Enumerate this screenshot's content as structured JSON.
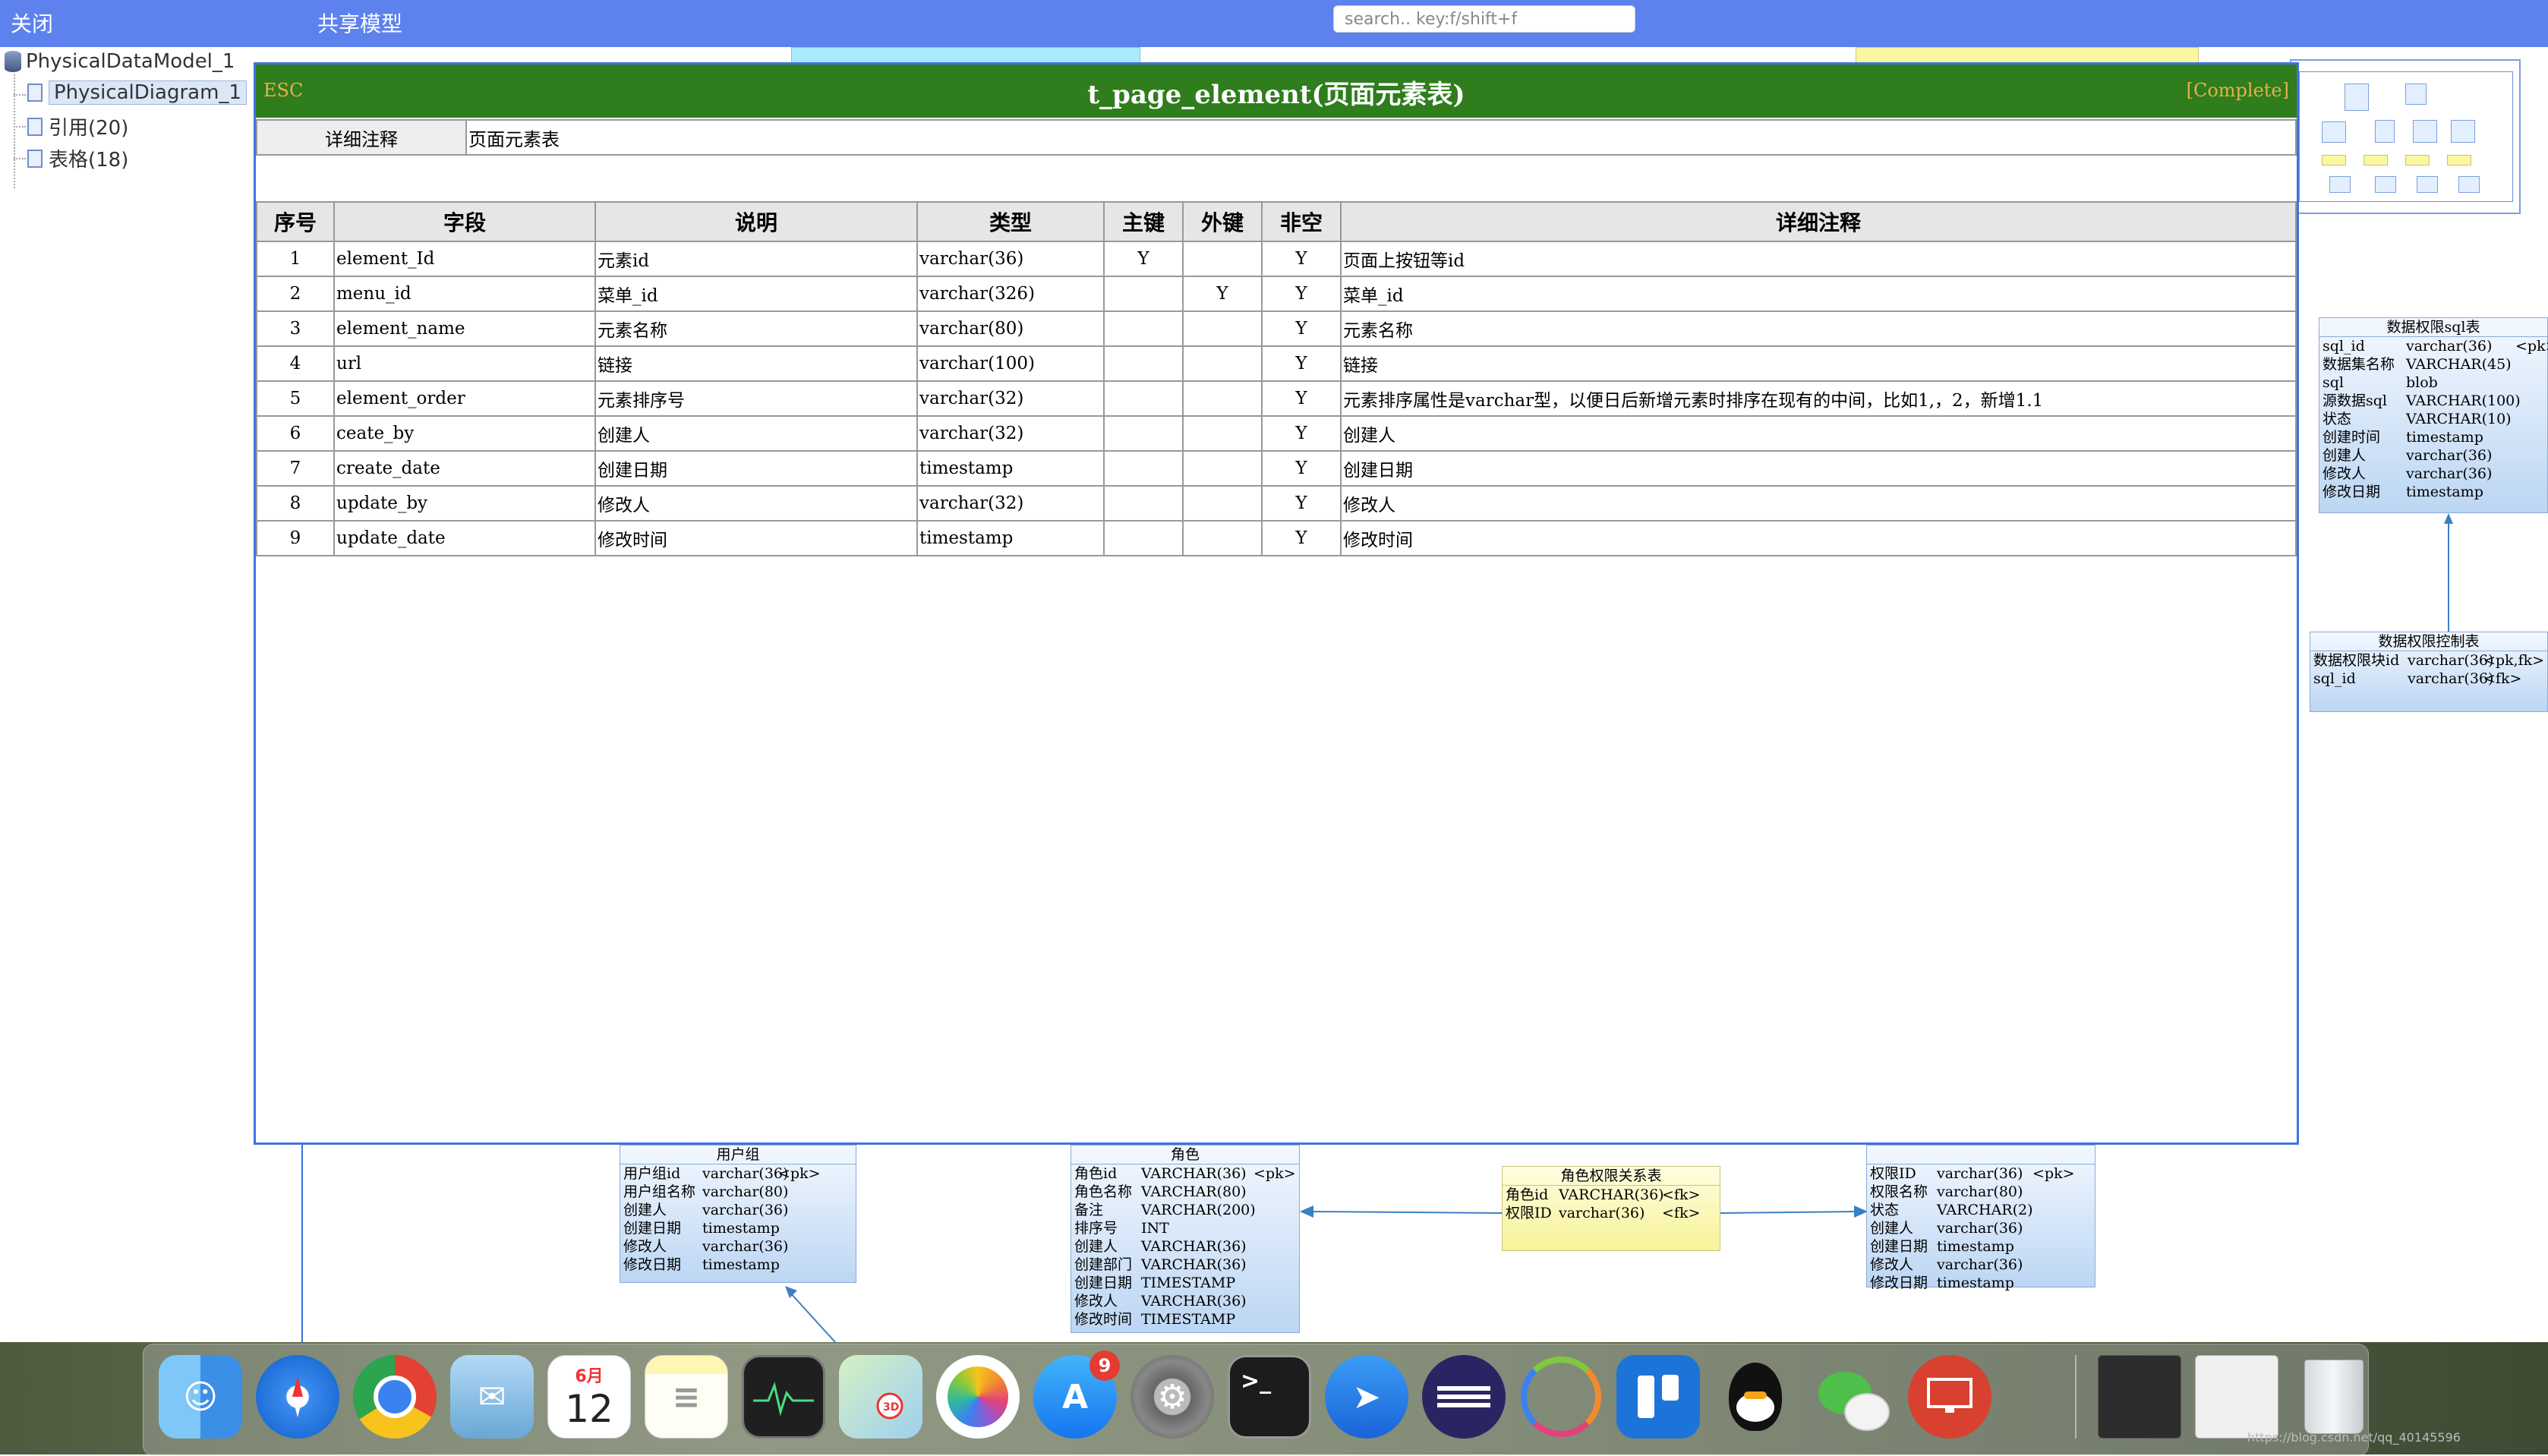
{
  "topbar": {
    "close_label": "关闭",
    "share_label": "共享模型",
    "search_placeholder": "search.. key:f/shift+f"
  },
  "tree": {
    "root": "PhysicalDataModel_1",
    "diagram": "PhysicalDiagram_1",
    "references": "引用(20)",
    "tables": "表格(18)"
  },
  "modal": {
    "esc_label": "ESC",
    "title": "t_page_element(页面元素表)",
    "complete_label": "[Complete]",
    "note_label": "详细注释",
    "note_value": "页面元素表",
    "columns": [
      "序号",
      "字段",
      "说明",
      "类型",
      "主键",
      "外键",
      "非空",
      "详细注释"
    ],
    "rows": [
      {
        "no": "1",
        "field": "element_Id",
        "desc": "元素id",
        "type": "varchar(36)",
        "pk": "Y",
        "fk": "",
        "nn": "Y",
        "note": "页面上按钮等id"
      },
      {
        "no": "2",
        "field": "menu_id",
        "desc": "菜单_id",
        "type": "varchar(326)",
        "pk": "",
        "fk": "Y",
        "nn": "Y",
        "note": "菜单_id"
      },
      {
        "no": "3",
        "field": "element_name",
        "desc": "元素名称",
        "type": "varchar(80)",
        "pk": "",
        "fk": "",
        "nn": "Y",
        "note": "元素名称"
      },
      {
        "no": "4",
        "field": "url",
        "desc": "链接",
        "type": "varchar(100)",
        "pk": "",
        "fk": "",
        "nn": "Y",
        "note": "链接"
      },
      {
        "no": "5",
        "field": "element_order",
        "desc": "元素排序号",
        "type": "varchar(32)",
        "pk": "",
        "fk": "",
        "nn": "Y",
        "note": "元素排序属性是varchar型，以便日后新增元素时排序在现有的中间，比如1,，2，新增1.1"
      },
      {
        "no": "6",
        "field": "ceate_by",
        "desc": "创建人",
        "type": "varchar(32)",
        "pk": "",
        "fk": "",
        "nn": "Y",
        "note": "创建人"
      },
      {
        "no": "7",
        "field": "create_date",
        "desc": "创建日期",
        "type": "timestamp",
        "pk": "",
        "fk": "",
        "nn": "Y",
        "note": "创建日期"
      },
      {
        "no": "8",
        "field": "update_by",
        "desc": "修改人",
        "type": "varchar(32)",
        "pk": "",
        "fk": "",
        "nn": "Y",
        "note": "修改人"
      },
      {
        "no": "9",
        "field": "update_date",
        "desc": "修改时间",
        "type": "timestamp",
        "pk": "",
        "fk": "",
        "nn": "Y",
        "note": "修改时间"
      }
    ]
  },
  "entities": {
    "sql_table": {
      "title": "数据权限sql表",
      "rows": [
        [
          "sql_id",
          "varchar(36)",
          "<pk>"
        ],
        [
          "数据集名称",
          "VARCHAR(45)",
          ""
        ],
        [
          "sql",
          "blob",
          ""
        ],
        [
          "源数据sql",
          "VARCHAR(100)",
          ""
        ],
        [
          "状态",
          "VARCHAR(10)",
          ""
        ],
        [
          "创建时间",
          "timestamp",
          ""
        ],
        [
          "创建人",
          "varchar(36)",
          ""
        ],
        [
          "修改人",
          "varchar(36)",
          ""
        ],
        [
          "修改日期",
          "timestamp",
          ""
        ]
      ]
    },
    "control_table": {
      "title": "数据权限控制表",
      "rows": [
        [
          "数据权限块id",
          "varchar(36)",
          "<pk,fk>"
        ],
        [
          "sql_id",
          "varchar(36)",
          "<fk>"
        ]
      ]
    },
    "user_group": {
      "title": "用户组",
      "rows": [
        [
          "用户组id",
          "varchar(36)",
          "<pk>"
        ],
        [
          "用户组名称",
          "varchar(80)",
          ""
        ],
        [
          "创建人",
          "varchar(36)",
          ""
        ],
        [
          "创建日期",
          "timestamp",
          ""
        ],
        [
          "修改人",
          "varchar(36)",
          ""
        ],
        [
          "修改日期",
          "timestamp",
          ""
        ]
      ]
    },
    "role": {
      "title": "角色",
      "rows": [
        [
          "角色id",
          "VARCHAR(36)",
          "<pk>"
        ],
        [
          "角色名称",
          "VARCHAR(80)",
          ""
        ],
        [
          "备注",
          "VARCHAR(200)",
          ""
        ],
        [
          "排序号",
          "INT",
          ""
        ],
        [
          "创建人",
          "VARCHAR(36)",
          ""
        ],
        [
          "创建部门",
          "VARCHAR(36)",
          ""
        ],
        [
          "创建日期",
          "TIMESTAMP",
          ""
        ],
        [
          "修改人",
          "VARCHAR(36)",
          ""
        ],
        [
          "修改时间",
          "TIMESTAMP",
          ""
        ]
      ]
    },
    "role_perm": {
      "title": "角色权限关系表",
      "rows": [
        [
          "角色id",
          "VARCHAR(36)",
          "<fk>"
        ],
        [
          "权限ID",
          "varchar(36)",
          "<fk>"
        ]
      ]
    },
    "permission": {
      "title": "",
      "rows": [
        [
          "权限ID",
          "varchar(36)",
          "<pk>"
        ],
        [
          "权限名称",
          "varchar(80)",
          ""
        ],
        [
          "状态",
          "VARCHAR(2)",
          ""
        ],
        [
          "创建人",
          "varchar(36)",
          ""
        ],
        [
          "创建日期",
          "timestamp",
          ""
        ],
        [
          "修改人",
          "varchar(36)",
          ""
        ],
        [
          "修改日期",
          "timestamp",
          ""
        ]
      ]
    }
  },
  "dock": {
    "calendar_month": "6月",
    "calendar_day": "12",
    "appstore_badge": "9",
    "terminal_prompt": ">_"
  },
  "watermark": "https://blog.csdn.net/qq_40145596"
}
